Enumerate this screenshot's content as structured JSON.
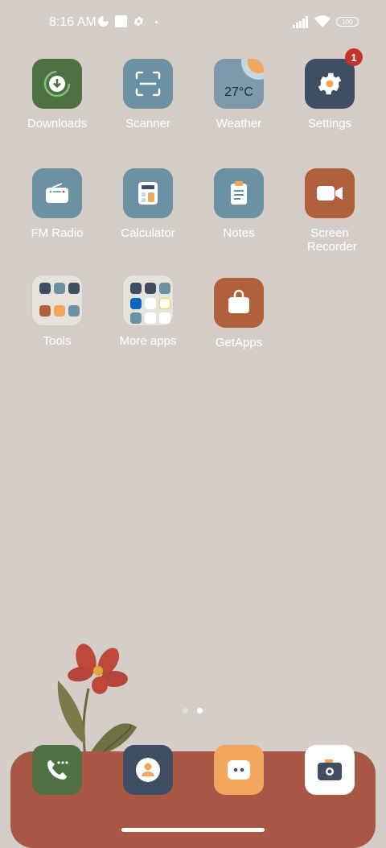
{
  "status_bar": {
    "time": "8:16 AM",
    "battery": "100",
    "icons": [
      "data-saver-icon",
      "square-notification-icon",
      "gear-icon",
      "dot-icon",
      "signal-icon",
      "wifi-icon",
      "battery-icon"
    ]
  },
  "apps": {
    "row1": [
      {
        "label": "Downloads",
        "icon": "download-icon",
        "color": "#4e7043"
      },
      {
        "label": "Scanner",
        "icon": "scanner-icon",
        "color": "#6b91a3"
      },
      {
        "label": "Weather",
        "icon": "weather-icon",
        "color": "#7c9aab",
        "temp": "27°C"
      },
      {
        "label": "Settings",
        "icon": "gear-icon",
        "color": "#3f4e63",
        "badge": "1"
      }
    ],
    "row2": [
      {
        "label": "FM Radio",
        "icon": "radio-icon",
        "color": "#6b91a3"
      },
      {
        "label": "Calculator",
        "icon": "calculator-icon",
        "color": "#6b91a3"
      },
      {
        "label": "Notes",
        "icon": "clipboard-icon",
        "color": "#6b91a3"
      },
      {
        "label": "Screen Recorder",
        "icon": "video-camera-icon",
        "color": "#b0603a"
      }
    ],
    "row3": [
      {
        "label": "Tools",
        "icon": "folder-icon"
      },
      {
        "label": "More apps",
        "icon": "folder-icon"
      },
      {
        "label": "GetApps",
        "icon": "shopping-bag-icon",
        "color": "#b0603a"
      }
    ]
  },
  "dock": [
    {
      "name": "phone",
      "icon": "phone-icon",
      "color": "#4e7043"
    },
    {
      "name": "contacts",
      "icon": "contact-icon",
      "color": "#3f4e63"
    },
    {
      "name": "messages",
      "icon": "message-icon",
      "color": "#f2a55c"
    },
    {
      "name": "camera",
      "icon": "camera-icon",
      "color": "#ffffff"
    }
  ],
  "pager": {
    "pages": 2,
    "current": 2
  },
  "colors": {
    "wallpaper": "#d5cec8",
    "dock": "#a95848",
    "text": "#ffffff"
  }
}
